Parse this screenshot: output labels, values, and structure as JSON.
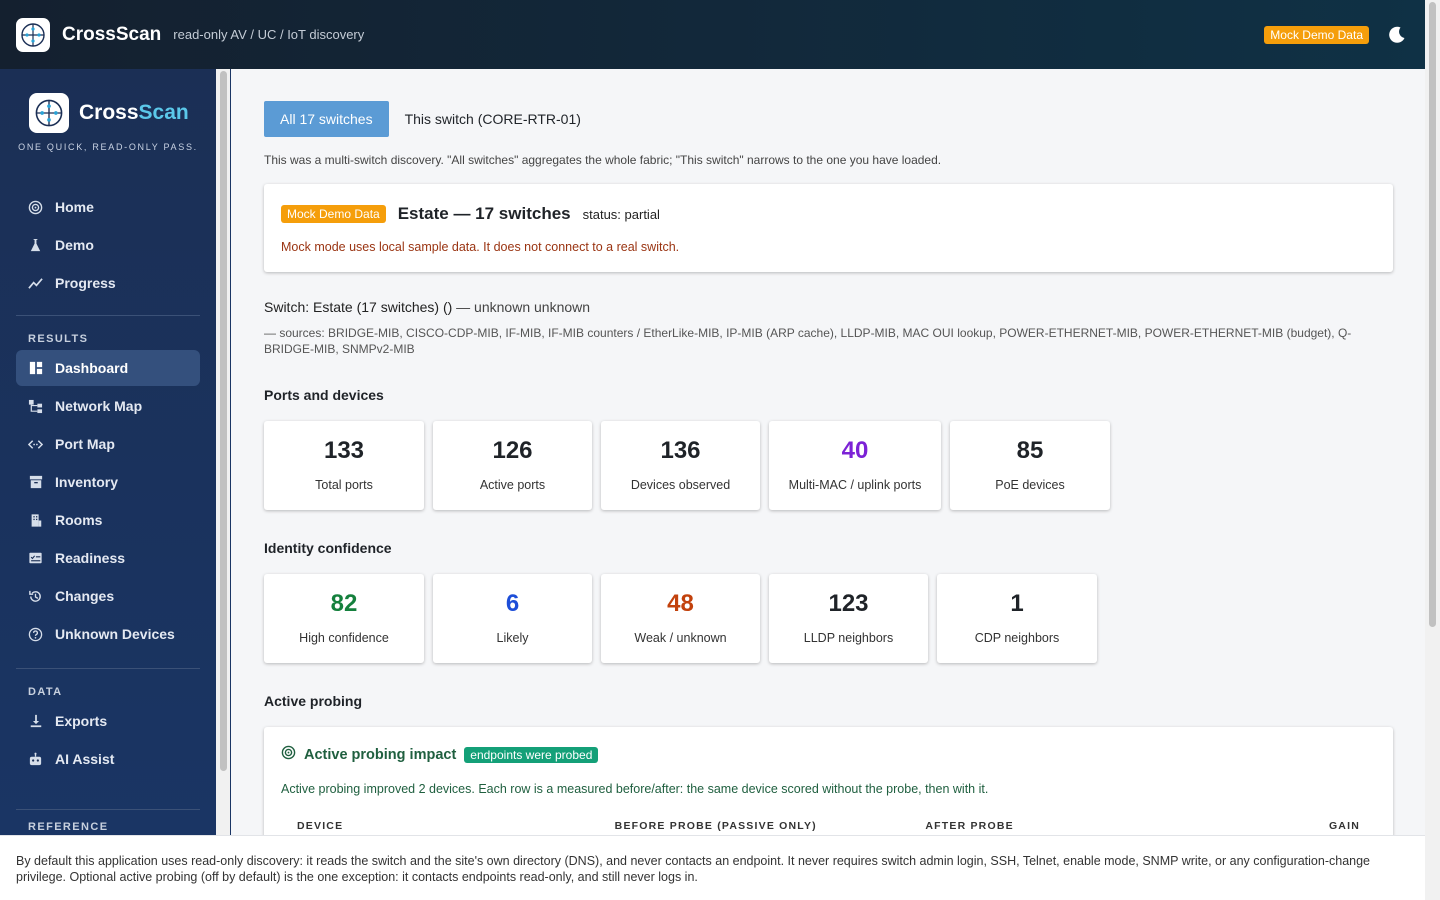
{
  "header": {
    "title": "CrossScan",
    "subtitle": "read-only AV / UC / IoT discovery",
    "mock_badge": "Mock Demo Data",
    "theme_icon": "moon-icon"
  },
  "sidebar": {
    "brand_a": "Cross",
    "brand_b": "Scan",
    "tagline": "ONE QUICK, READ-ONLY PASS.",
    "primary": [
      {
        "label": "Home",
        "icon": "target-icon"
      },
      {
        "label": "Demo",
        "icon": "flask-icon"
      },
      {
        "label": "Progress",
        "icon": "trend-icon"
      }
    ],
    "results_title": "RESULTS",
    "results": [
      {
        "label": "Dashboard",
        "icon": "dashboard-icon"
      },
      {
        "label": "Network Map",
        "icon": "network-icon"
      },
      {
        "label": "Port Map",
        "icon": "code-arrows-icon"
      },
      {
        "label": "Inventory",
        "icon": "archive-icon"
      },
      {
        "label": "Rooms",
        "icon": "building-icon"
      },
      {
        "label": "Readiness",
        "icon": "checklist-icon"
      },
      {
        "label": "Changes",
        "icon": "history-icon"
      },
      {
        "label": "Unknown Devices",
        "icon": "question-icon"
      }
    ],
    "data_title": "DATA",
    "data": [
      {
        "label": "Exports",
        "icon": "download-icon"
      },
      {
        "label": "AI Assist",
        "icon": "robot-icon"
      }
    ],
    "reference_title": "REFERENCE"
  },
  "main": {
    "tabs": [
      "All 17 switches",
      "This switch (CORE-RTR-01)"
    ],
    "hint": "This was a multi-switch discovery. \"All switches\" aggregates the whole fabric; \"This switch\" narrows to the one you have loaded.",
    "mock_card": {
      "badge": "Mock Demo Data",
      "title": "Estate — 17 switches",
      "status": "status: partial",
      "note": "Mock mode uses local sample data. It does not connect to a real switch."
    },
    "switch_line": "Switch: Estate (17 switches) ()",
    "switch_line_muted": " — unknown unknown",
    "sources": "— sources: BRIDGE-MIB, CISCO-CDP-MIB, IF-MIB, IF-MIB counters / EtherLike-MIB, IP-MIB (ARP cache), LLDP-MIB, MAC OUI lookup, POWER-ETHERNET-MIB, POWER-ETHERNET-MIB (budget), Q-BRIDGE-MIB, SNMPv2-MIB",
    "ports_title": "Ports and devices",
    "ports": [
      {
        "value": "133",
        "label": "Total ports",
        "color": "#1f2328"
      },
      {
        "value": "126",
        "label": "Active ports",
        "color": "#1f2328"
      },
      {
        "value": "136",
        "label": "Devices observed",
        "color": "#1f2328"
      },
      {
        "value": "40",
        "label": "Multi-MAC / uplink ports",
        "color": "#7c22d6"
      },
      {
        "value": "85",
        "label": "PoE devices",
        "color": "#1f2328"
      }
    ],
    "identity_title": "Identity confidence",
    "identity": [
      {
        "value": "82",
        "label": "High confidence",
        "color": "#15803d"
      },
      {
        "value": "6",
        "label": "Likely",
        "color": "#1d4ed8"
      },
      {
        "value": "48",
        "label": "Weak / unknown",
        "color": "#c2410c"
      },
      {
        "value": "123",
        "label": "LLDP neighbors",
        "color": "#1f2328"
      },
      {
        "value": "1",
        "label": "CDP neighbors",
        "color": "#1f2328"
      }
    ],
    "probing_title": "Active probing",
    "probing_card": {
      "title": "Active probing impact",
      "badge": "endpoints were probed",
      "desc": "Active probing improved 2 devices. Each row is a measured before/after: the same device scored without the probe, then with it.",
      "columns": [
        "DEVICE",
        "BEFORE PROBE (PASSIVE ONLY)",
        "AFTER PROBE",
        "GAIN"
      ]
    }
  },
  "footer": {
    "text": "By default this application uses read-only discovery: it reads the switch and the site's own directory (DNS), and never contacts an endpoint. It never requires switch admin login, SSH, Telnet, enable mode, SNMP write, or any configuration-change privilege. Optional active probing (off by default) is the one exception: it contacts endpoints read-only, and still never logs in."
  }
}
